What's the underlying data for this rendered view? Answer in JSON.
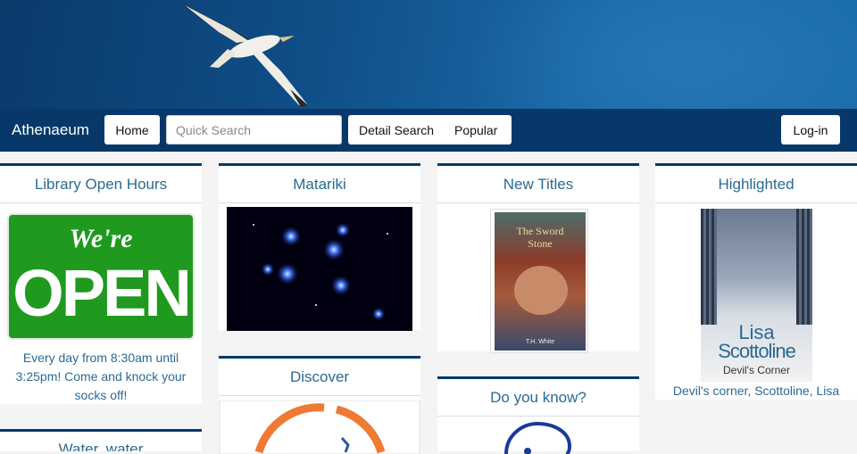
{
  "header": {
    "brand": "Athenaeum"
  },
  "nav": {
    "home_label": "Home",
    "search_placeholder": "Quick Search",
    "detail_search_label": "Detail Search",
    "popular_label": "Popular",
    "login_label": "Log-in"
  },
  "cards": {
    "hours": {
      "title": "Library Open Hours",
      "sign_script": "We're",
      "sign_big": "OPEN",
      "caption": "Every day from 8:30am until 3:25pm! Come and knock your socks off!"
    },
    "matariki": {
      "title": "Matariki"
    },
    "new_titles": {
      "title": "New Titles",
      "book_title_line1": "The Sword",
      "book_title_line2": "Stone",
      "book_author": "T.H. White"
    },
    "highlighted": {
      "title": "Highlighted",
      "book_author_first": "Lisa",
      "book_author_last": "Scottoline",
      "book_title": "Devil's Corner",
      "caption": "Devil's corner, Scottoline, Lisa"
    },
    "discover": {
      "title": "Discover"
    },
    "do_you_know": {
      "title": "Do you know?"
    },
    "water": {
      "title": "Water, water"
    }
  },
  "colors": {
    "navbar": "#073869",
    "title_text": "#2a6a95",
    "sign_green": "#1f9a1f"
  }
}
